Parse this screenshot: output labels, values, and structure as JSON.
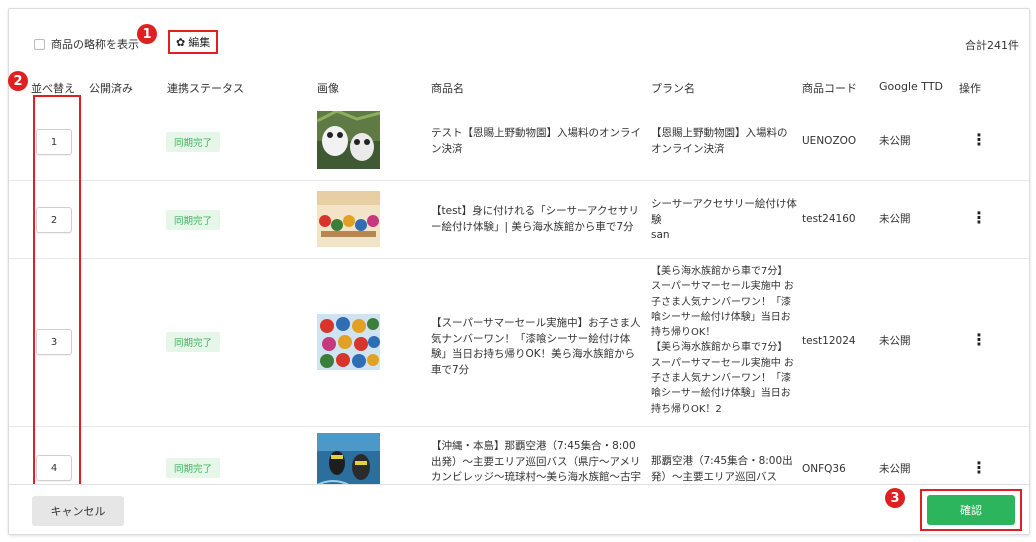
{
  "toolbar": {
    "abbr_label": "商品の略称を表示",
    "edit_icon": "gear-icon",
    "edit_label": "編集",
    "total": "合計241件"
  },
  "markers": [
    "1",
    "2",
    "3"
  ],
  "columns": {
    "order": "並べ替え",
    "published": "公開済み",
    "status": "連携ステータス",
    "image": "画像",
    "product_name": "商品名",
    "plan_name": "プラン名",
    "code": "商品コード",
    "google": "Google TTD",
    "action": "操作"
  },
  "rows": [
    {
      "order": "1",
      "status": "同期完了",
      "product_name": "テスト【恩賜上野動物園】入場料のオンライン決済",
      "plan_name": "【恩賜上野動物園】入場料のオンライン決済",
      "code": "UENOZOO",
      "google": "未公開",
      "kebab": "⋮"
    },
    {
      "order": "2",
      "status": "同期完了",
      "product_name": "【test】身に付けれる「シーサーアクセサリー絵付け体験」| 美ら海水族館から車で7分",
      "plan_name": "シーサーアクセサリー絵付け体験\nsan",
      "code": "test24160",
      "google": "未公開",
      "kebab": "⋮"
    },
    {
      "order": "3",
      "status": "同期完了",
      "product_name": "【スーパーサマーセール実施中】お子さま人気ナンバーワン！「漆喰シーサー絵付け体験」当日お持ち帰りOK！美ら海水族館から車で7分",
      "plan_name": "【美ら海水族館から車で7分】スーパーサマーセール実施中 お子さま人気ナンバーワン！「漆喰シーサー絵付け体験」当日お持ち帰りOK！\n【美ら海水族館から車で7分】スーパーサマーセール実施中 お子さま人気ナンバーワン！「漆喰シーサー絵付け体験」当日お持ち帰りOK！2",
      "code": "test12024",
      "google": "未公開",
      "kebab": "⋮"
    },
    {
      "order": "4",
      "status": "同期完了",
      "product_name": "【沖縄・本島】那覇空港（7:45集合・8:00出発）～主要エリア巡回バス（県庁～アメリカンビレッジ～琉球村～美ら海水族館～古宇利島～他）",
      "plan_name": "那覇空港（7:45集合・8:00出発）～主要エリア巡回バス",
      "code": "ONFQ36",
      "google": "未公開",
      "kebab": "⋮"
    }
  ],
  "footer": {
    "cancel": "キャンセル",
    "confirm": "確認"
  },
  "colors": {
    "accent_red": "#e02020",
    "confirm_green": "#2db55d",
    "badge_green": "#3eb35a"
  }
}
